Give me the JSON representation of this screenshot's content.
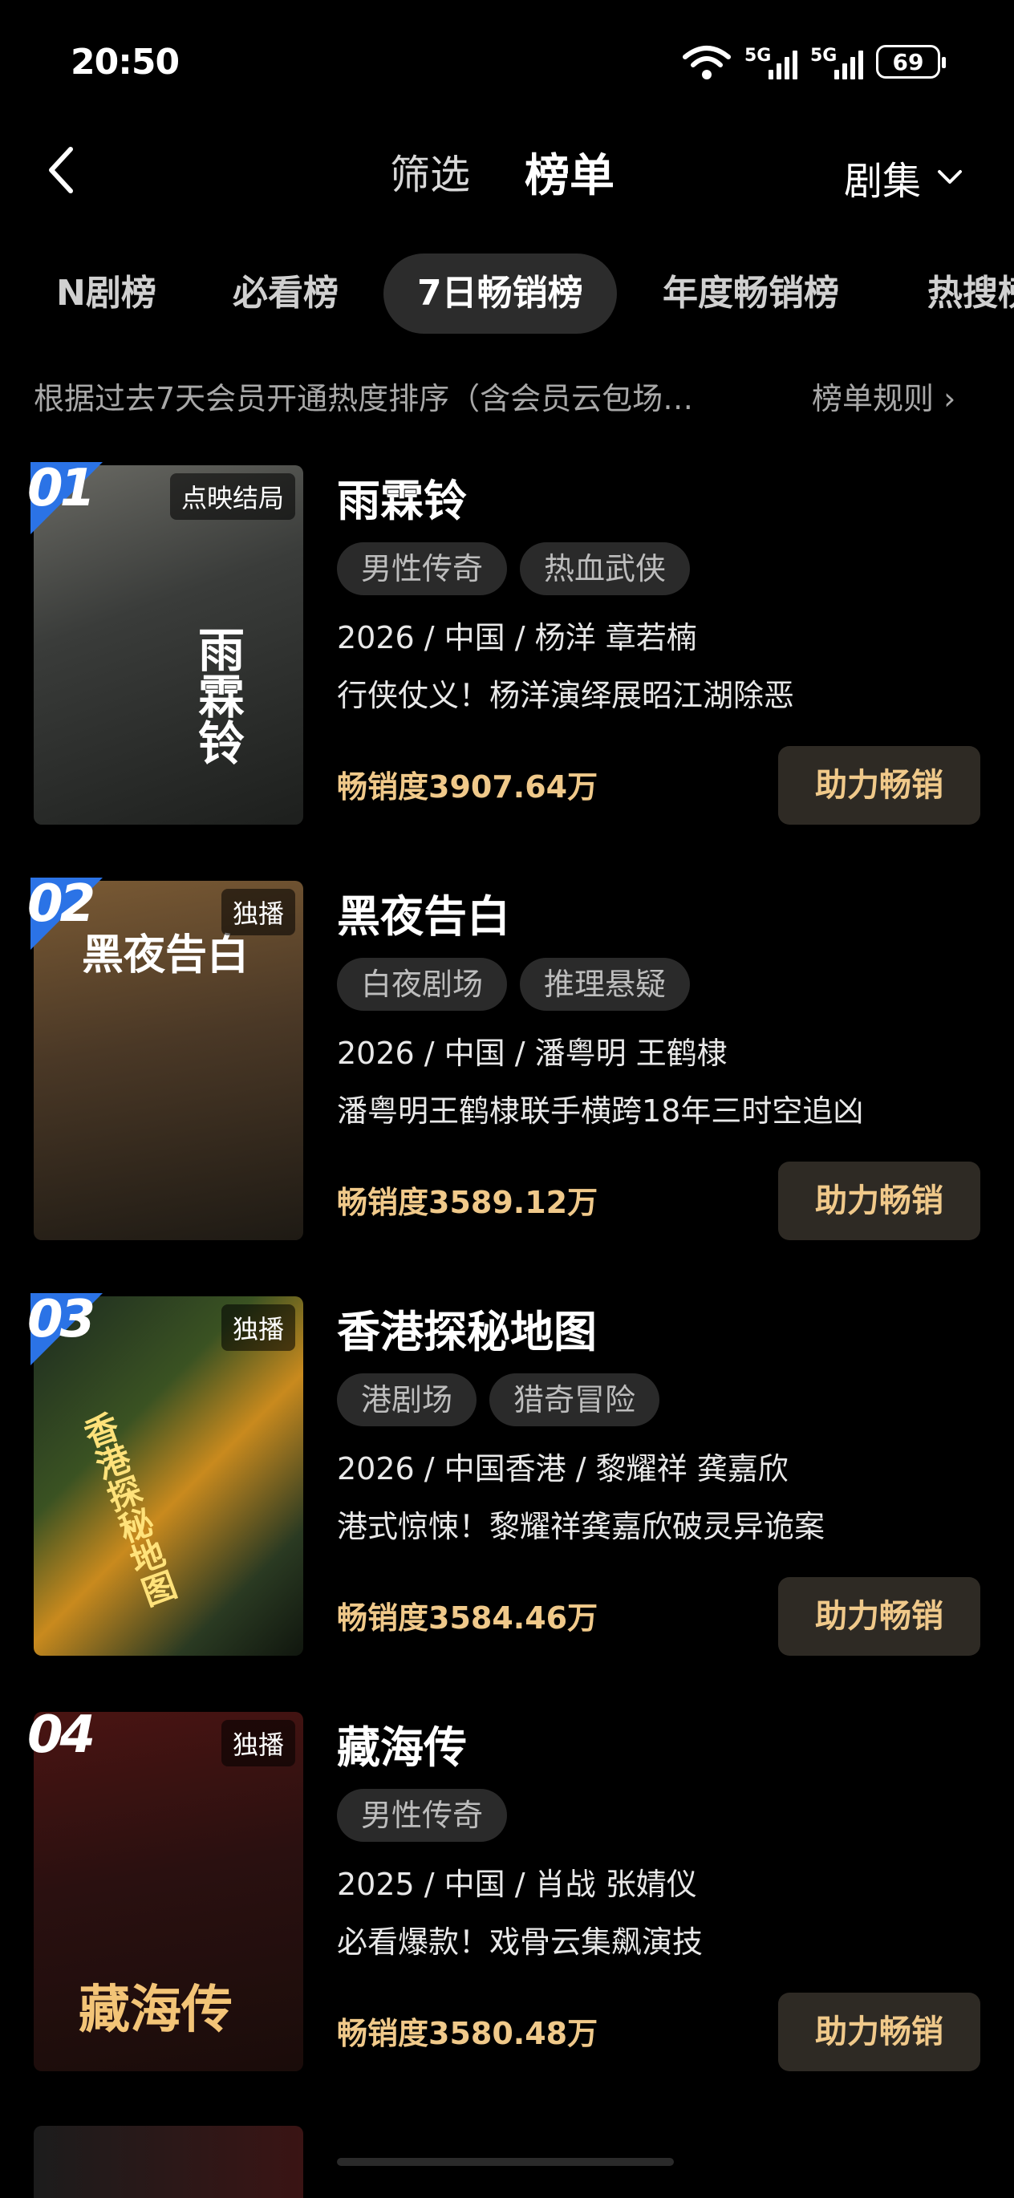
{
  "status": {
    "time": "20:50",
    "net1": "5G",
    "net2": "5G",
    "battery": "69"
  },
  "header": {
    "filter_label": "筛选",
    "rank_label": "榜单",
    "category": "剧集"
  },
  "tabs": [
    {
      "label": "N剧榜"
    },
    {
      "label": "必看榜"
    },
    {
      "label": "7日畅销榜"
    },
    {
      "label": "年度畅销榜"
    },
    {
      "label": "热搜榜"
    }
  ],
  "description": "根据过去7天会员开通热度排序（含会员云包场…",
  "rules_label": "榜单规则",
  "boost_label": "助力畅销",
  "items": [
    {
      "rank": "01",
      "badge": "点映结局",
      "poster_text": "雨霖铃",
      "title": "雨霖铃",
      "tags": [
        "男性传奇",
        "热血武侠"
      ],
      "meta": "2026 / 中国 / 杨洋 章若楠",
      "intro": "行侠仗义！杨洋演绎展昭江湖除恶",
      "sales": "畅销度3907.64万"
    },
    {
      "rank": "02",
      "badge": "独播",
      "poster_text": "黑夜告白",
      "title": "黑夜告白",
      "tags": [
        "白夜剧场",
        "推理悬疑"
      ],
      "meta": "2026 / 中国 / 潘粤明 王鹤棣",
      "intro": "潘粤明王鹤棣联手横跨18年三时空追凶",
      "sales": "畅销度3589.12万"
    },
    {
      "rank": "03",
      "badge": "独播",
      "poster_text": "香港探秘地图",
      "title": "香港探秘地图",
      "tags": [
        "港剧场",
        "猎奇冒险"
      ],
      "meta": "2026 / 中国香港 / 黎耀祥 龚嘉欣",
      "intro": "港式惊悚！黎耀祥龚嘉欣破灵异诡案",
      "sales": "畅销度3584.46万"
    },
    {
      "rank": "04",
      "badge": "独播",
      "poster_text": "藏海传",
      "title": "藏海传",
      "tags": [
        "男性传奇"
      ],
      "meta": "2025 / 中国 / 肖战 张婧仪",
      "intro": "必看爆款！戏骨云集飙演技",
      "sales": "畅销度3580.48万"
    }
  ]
}
